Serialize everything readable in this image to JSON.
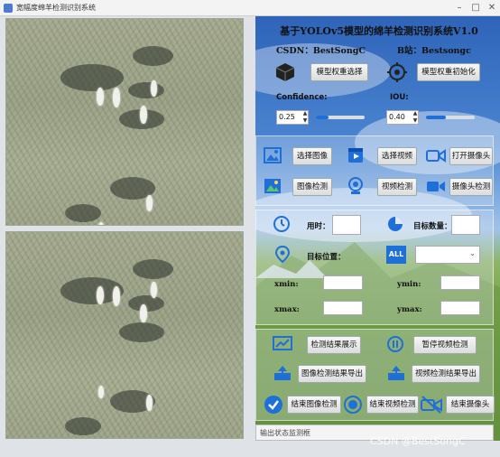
{
  "window": {
    "title": "宽幅度绵羊检测识别系统"
  },
  "header": {
    "title": "基于YOLOv5模型的绵羊检测识别系统V1.0",
    "csdn": "CSDN：BestSongC",
    "bilibili": "B站：Bestsongc"
  },
  "model": {
    "select_label": "模型权重选择",
    "init_label": "模型权重初始化",
    "cube_icon": "cube-icon",
    "target_icon": "target-icon"
  },
  "params": {
    "confidence_label": "Confidence:",
    "confidence_value": "0.25",
    "confidence_slider": 0.25,
    "iou_label": "IOU:",
    "iou_value": "0.40",
    "iou_slider": 0.4
  },
  "input_buttons": {
    "select_image": "选择图像",
    "select_video": "选择视频",
    "open_camera": "打开摄像头",
    "image_detect": "图像检测",
    "video_detect": "视频检测",
    "camera_detect": "摄像头检测"
  },
  "stats": {
    "time_label": "用时：",
    "count_label": "目标数量：",
    "position_label": "目标位置：",
    "select_value": "",
    "xmin_label": "xmin:",
    "ymin_label": "ymin:",
    "xmax_label": "xmax:",
    "ymax_label": "ymax:"
  },
  "actions": {
    "show_results": "检测结果展示",
    "pause_video": "暂停视频检测",
    "export_image": "图像检测结果导出",
    "export_video": "视频检测结果导出",
    "end_image": "结束图像检测",
    "end_video": "结束视频检测",
    "end_camera": "结束摄像头"
  },
  "status": {
    "text": "输出状态监测框"
  },
  "watermark": "CSDN @BestSongC",
  "colors": {
    "accent": "#1e6fd8",
    "title_text": "#111111",
    "panel_blue": "#2f64b8",
    "grass": "#a3a88e"
  }
}
